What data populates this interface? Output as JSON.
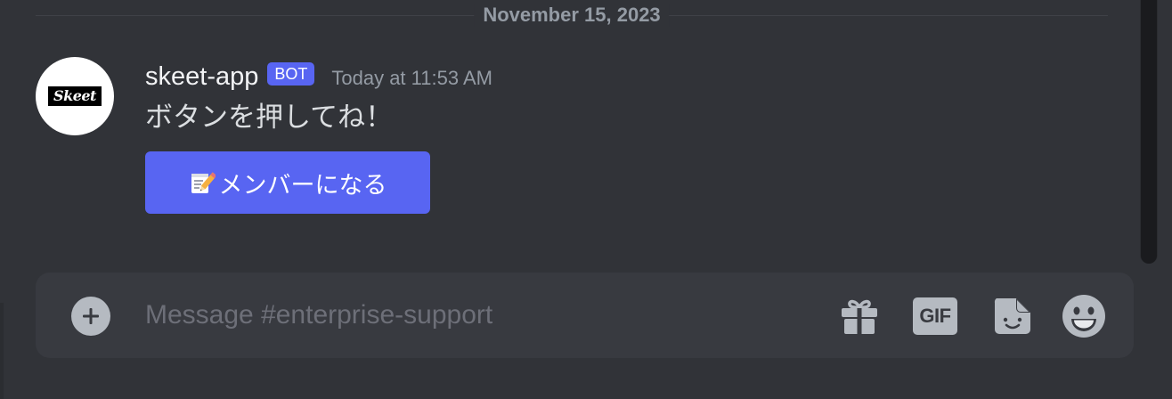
{
  "divider": {
    "date": "November 15, 2023"
  },
  "message": {
    "avatar_text": "Skeet",
    "username": "skeet-app",
    "bot_tag": "BOT",
    "timestamp": "Today at 11:53 AM",
    "content": "ボタンを押してね！",
    "button": {
      "emoji": "memo-icon",
      "label": "メンバーになる"
    }
  },
  "composer": {
    "placeholder": "Message #enterprise-support",
    "value": "",
    "gif_label": "GIF",
    "icons": [
      "plus-circle-icon",
      "gift-icon",
      "gif-icon",
      "sticker-icon",
      "emoji-smile-icon"
    ]
  },
  "colors": {
    "background": "#313338",
    "composer": "#383a40",
    "blurple": "#5865f2",
    "muted_text": "#949ba4",
    "icon_gray": "#b5bac1"
  }
}
